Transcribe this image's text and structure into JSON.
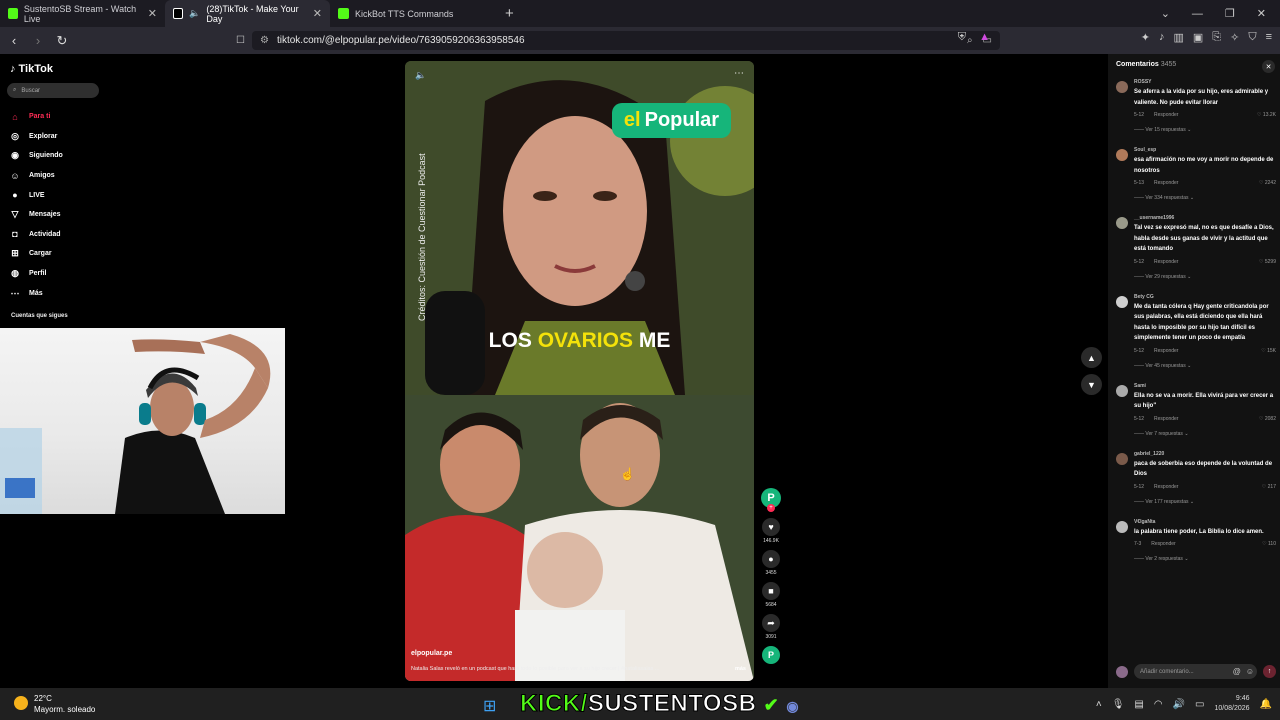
{
  "browser": {
    "tabs": [
      {
        "label": "SustentoSB Stream - Watch Live",
        "favicon_color": "#53fc18"
      },
      {
        "label": "(28)TikTok - Make Your Day",
        "favicon_color": "#000000"
      },
      {
        "label": "KickBot TTS Commands",
        "favicon_color": "#53fc18"
      }
    ],
    "url": "tiktok.com/@elpopular.pe/video/7639059206363958546"
  },
  "tiktok": {
    "logo": "TikTok",
    "search_placeholder": "Buscar",
    "nav": [
      {
        "label": "Para ti",
        "icon": "home-icon"
      },
      {
        "label": "Explorar",
        "icon": "compass-icon"
      },
      {
        "label": "Siguiendo",
        "icon": "following-icon"
      },
      {
        "label": "Amigos",
        "icon": "friends-icon"
      },
      {
        "label": "LIVE",
        "icon": "live-icon"
      },
      {
        "label": "Mensajes",
        "icon": "messages-icon"
      },
      {
        "label": "Actividad",
        "icon": "activity-icon"
      },
      {
        "label": "Cargar",
        "icon": "upload-icon"
      },
      {
        "label": "Perfil",
        "icon": "profile-icon"
      },
      {
        "label": "Más",
        "icon": "more-icon"
      }
    ],
    "following_label": "Cuentas que sigues",
    "accent": "#fe2c55"
  },
  "video": {
    "brand_el": "el",
    "brand_popular": "Popular",
    "credits": "Créditos: Cuestión de Cuestionar Podcast",
    "caption_a": "LOS",
    "caption_b": "OVARIOS",
    "caption_c": "ME",
    "handle": "elpopular.pe",
    "description": "Natalia Salas reveló en un podcast que hará todo lo posible para ver a su hijo crecer | #nataliasalas ...",
    "more": "más"
  },
  "actions": [
    {
      "name": "like",
      "icon": "heart-icon",
      "glyph": "♥",
      "count": "146.9K"
    },
    {
      "name": "comment",
      "icon": "comment-icon",
      "glyph": "●",
      "count": "3455"
    },
    {
      "name": "save",
      "icon": "bookmark-icon",
      "glyph": "■",
      "count": "5684"
    },
    {
      "name": "share",
      "icon": "share-icon",
      "glyph": "➦",
      "count": "3091"
    }
  ],
  "comments": {
    "title": "Comentarios",
    "count": "3455",
    "reply_label": "Responder",
    "items": [
      {
        "user": "ROSSY",
        "text": "Se aferra a la vida por su hijo, eres admirable y valiente. No pude evitar llorar",
        "date": "5-12",
        "likes": "13.2K",
        "replies": "Ver 15 respuestas",
        "avatar": "#8a6a5a"
      },
      {
        "user": "Soul_esp",
        "text": "esa afirmación no me voy a morir no depende de nosotros",
        "date": "5-13",
        "likes": "2242",
        "replies": "Ver 334 respuestas",
        "avatar": "#b07a5a"
      },
      {
        "user": "__username1996",
        "text": "Tal vez se expresó mal, no es que desafíe a Dios, habla desde sus ganas de vivir y la actitud que está tomando",
        "date": "5-12",
        "likes": "5299",
        "replies": "Ver 29 respuestas",
        "avatar": "#9a9a8a"
      },
      {
        "user": "Bety CG",
        "text": "Me da tanta cólera q Hay gente criticandola por sus palabras, ella está diciendo que ella hará hasta lo imposible por su hijo tan difícil es simplemente tener un poco de empatía",
        "date": "5-12",
        "likes": "15K",
        "replies": "Ver 45 respuestas",
        "avatar": "#cfcfcf"
      },
      {
        "user": "Sami",
        "text": "Ella no se va a morir. Ella vivirá para ver crecer a su hijo\"",
        "date": "5-12",
        "likes": "2082",
        "replies": "Ver 7 respuestas",
        "avatar": "#aaaaaa"
      },
      {
        "user": "gabriel_1220",
        "text": "paca de soberbia eso depende de la voluntad de Dios",
        "date": "5-12",
        "likes": "217",
        "replies": "Ver 177 respuestas",
        "avatar": "#7a5a4a"
      },
      {
        "user": "V€lgaNta",
        "text": "la palabra tiene poder, La Biblia lo dice amen.",
        "date": "7-3",
        "likes": "110",
        "replies": "Ver 2 respuestas",
        "avatar": "#bbbbbb"
      }
    ],
    "input_placeholder": "Añadir comentario..."
  },
  "taskbar": {
    "temp": "22°C",
    "weather": "Mayorm. soleado",
    "kick_a": "KICK/",
    "kick_b": "SUSTENTOSB",
    "time": "9:46",
    "date": "10/08/2026"
  }
}
